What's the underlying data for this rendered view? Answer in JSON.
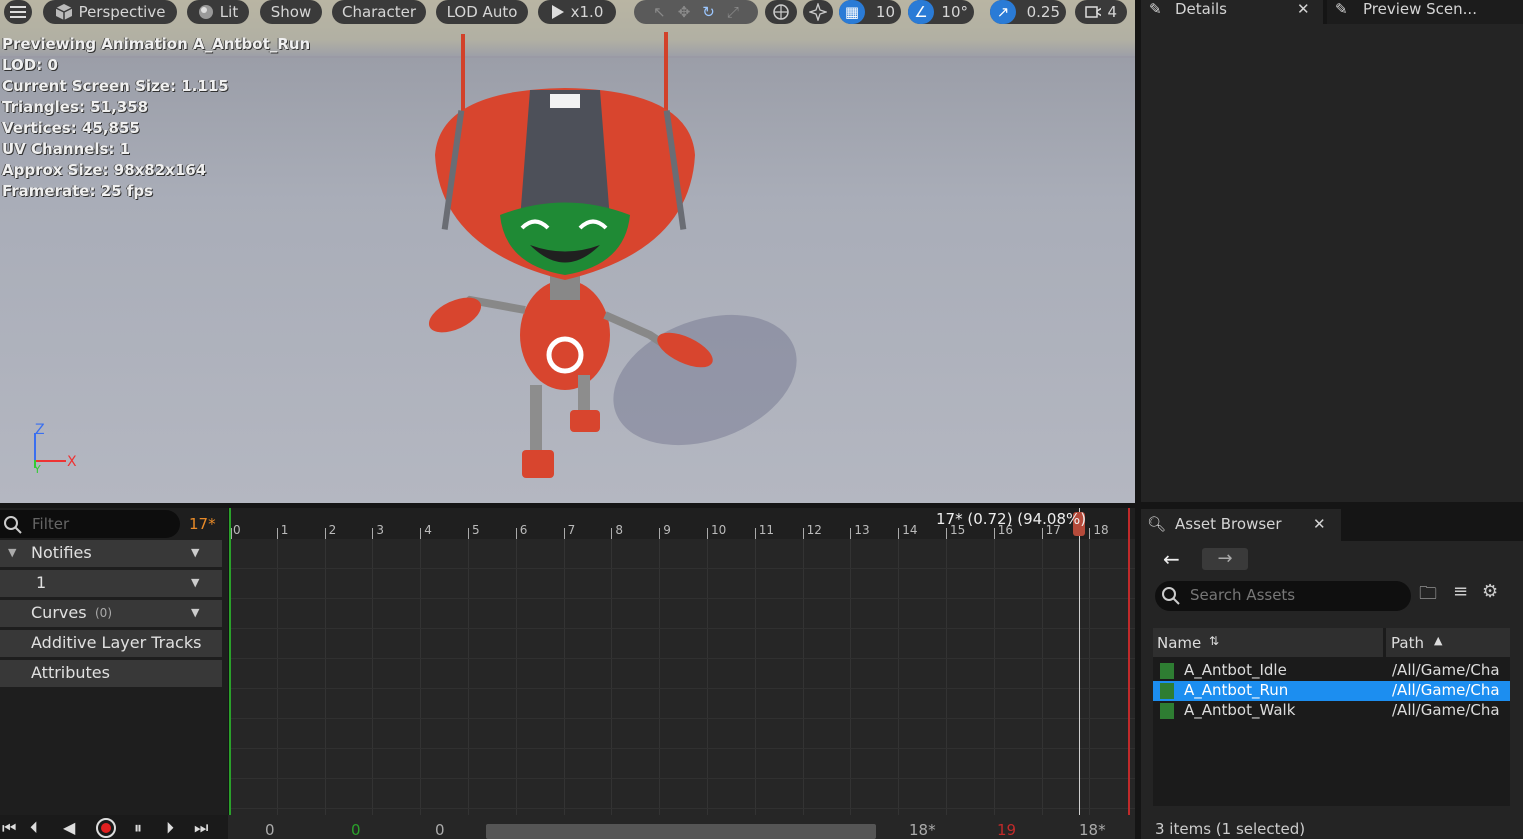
{
  "toolbar": {
    "menu_icon": "hamburger-icon",
    "perspective": "Perspective",
    "lit": "Lit",
    "show": "Show",
    "character": "Character",
    "lod": "LOD Auto",
    "play_speed": "x1.0",
    "grid_value": "10",
    "angle_value": "10°",
    "scale_value": "0.25",
    "camera_value": "4"
  },
  "overlay_stats": [
    "Previewing Animation A_Antbot_Run",
    "LOD: 0",
    "Current Screen Size: 1.115",
    "Triangles: 51,358",
    "Vertices: 45,855",
    "UV Channels: 1",
    "Approx Size: 98x82x164",
    "Framerate: 25 fps"
  ],
  "axis": {
    "z": "Z",
    "x": "X",
    "y": "Y"
  },
  "details_panel": {
    "details_tab": "Details",
    "preview_tab": "Preview Scen..."
  },
  "asset_browser": {
    "tab": "Asset Browser",
    "search_placeholder": "Search Assets",
    "columns": {
      "name": "Name",
      "path": "Path"
    },
    "rows": [
      {
        "name": "A_Antbot_Idle",
        "path": "/All/Game/Cha"
      },
      {
        "name": "A_Antbot_Run",
        "path": "/All/Game/Cha"
      },
      {
        "name": "A_Antbot_Walk",
        "path": "/All/Game/Cha"
      }
    ],
    "selected_index": 1,
    "status": "3 items (1 selected)"
  },
  "timeline": {
    "filter_placeholder": "Filter",
    "current_frame": "17*",
    "tracks": [
      {
        "label": "Notifies",
        "count": ""
      },
      {
        "label": "1",
        "count": ""
      },
      {
        "label": "Curves",
        "count": "(0)"
      },
      {
        "label": "Additive Layer Tracks",
        "count": ""
      },
      {
        "label": "Attributes",
        "count": ""
      }
    ],
    "ruler": [
      "0",
      "1",
      "2",
      "3",
      "4",
      "5",
      "6",
      "7",
      "8",
      "9",
      "10",
      "11",
      "12",
      "13",
      "14",
      "15",
      "16",
      "17",
      "18"
    ],
    "playhead_label": "17* (0.72) (94.08%)",
    "playhead_fraction": 0.9408
  },
  "transport": {
    "start_value": "0",
    "green_value": "0",
    "offset_value": "0",
    "end_frame": "18*",
    "red_value": "19",
    "end_frame_2": "18*"
  },
  "colors": {
    "accent": "#2a7bd6",
    "selection": "#1c8ef0",
    "frame": "#e88a28",
    "robot": "#e04a2e"
  }
}
